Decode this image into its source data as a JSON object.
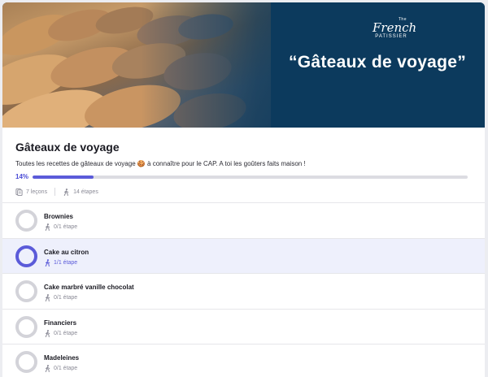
{
  "banner": {
    "brand_the": "The",
    "brand_french": "French",
    "brand_patissier": "PATISSIER",
    "title": "“Gâteaux de voyage”"
  },
  "course": {
    "title": "Gâteaux de voyage",
    "description": "Toutes les recettes de gâteaux de voyage 🍪 à connaître pour le CAP. A toi les goûters faits maison !",
    "progress_label": "14%",
    "progress_fraction": 0.14,
    "lessons": "7 leçons",
    "steps": "14 étapes"
  },
  "lessons": [
    {
      "title": "Brownies",
      "steps": "0/1 étape",
      "done": false
    },
    {
      "title": "Cake au citron",
      "steps": "1/1 étape",
      "done": true
    },
    {
      "title": "Cake marbré vanille chocolat",
      "steps": "0/1 étape",
      "done": false
    },
    {
      "title": "Financiers",
      "steps": "0/1 étape",
      "done": false
    },
    {
      "title": "Madeleines",
      "steps": "0/1 étape",
      "done": false
    }
  ],
  "colors": {
    "accent": "#5b5bd9",
    "banner_bg": "#0c3a5d",
    "ring_idle": "#d3d3d9",
    "active_row": "#eef0fc"
  },
  "icons": {
    "lessons": "lessons-icon",
    "steps": "walking-person-icon"
  }
}
